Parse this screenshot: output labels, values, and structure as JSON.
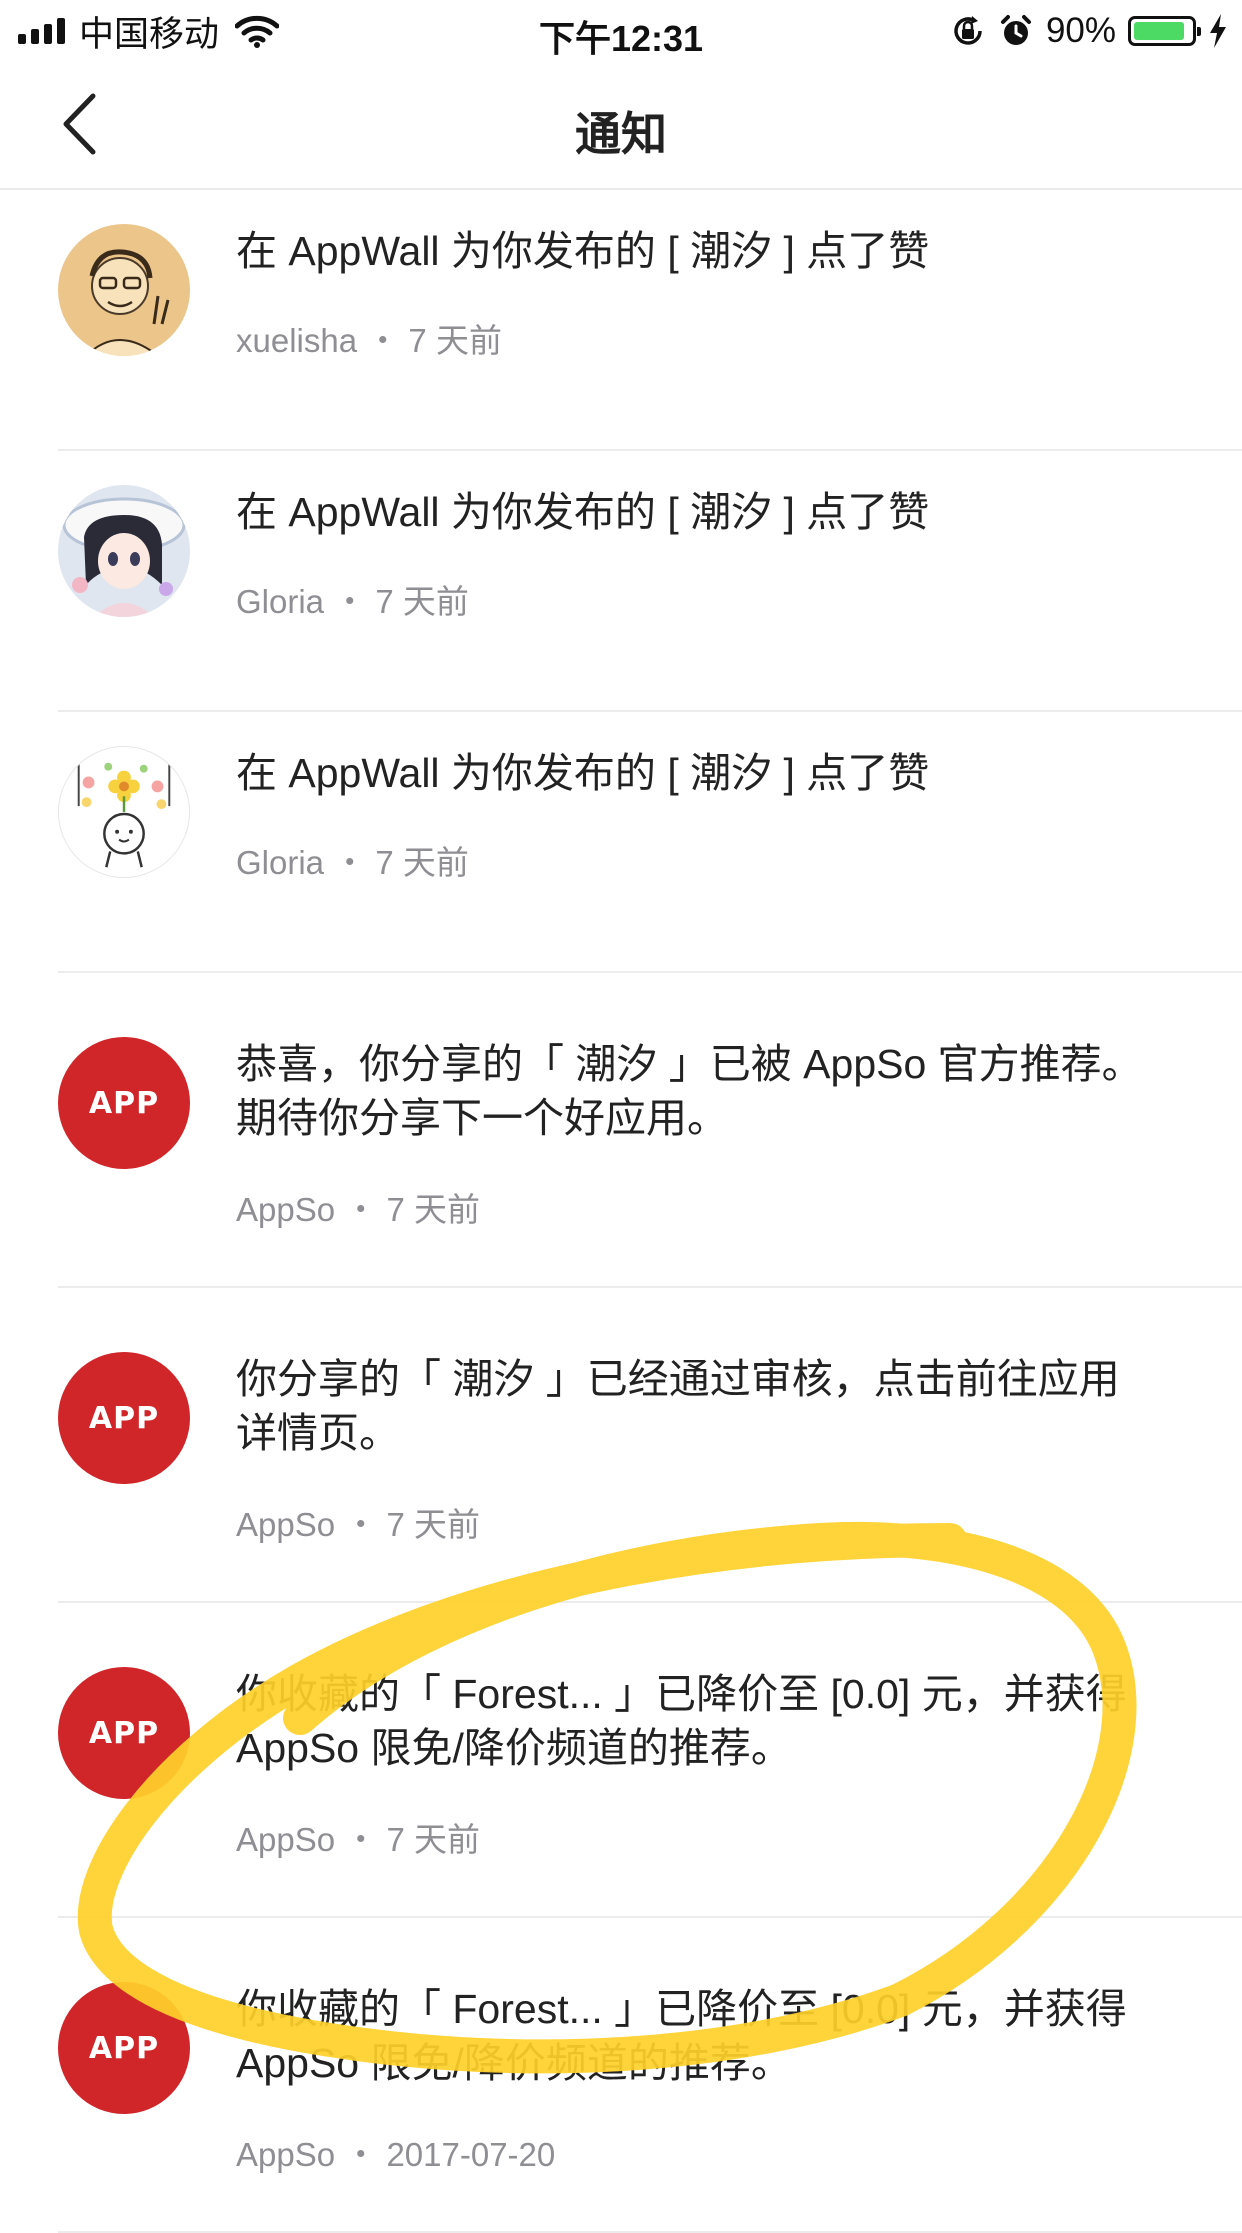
{
  "status_bar": {
    "carrier": "中国移动",
    "time": "下午12:31",
    "battery_percent": "90%",
    "battery_level": 0.9
  },
  "nav": {
    "title": "通知"
  },
  "notifications": [
    {
      "message": "在 AppWall 为你发布的 [ 潮汐 ] 点了赞",
      "user": "xuelisha",
      "separator": "・",
      "time": "7 天前",
      "avatar": "user-photo-avatar"
    },
    {
      "message": "在 AppWall 为你发布的 [ 潮汐 ] 点了赞",
      "user": "Gloria",
      "separator": "・",
      "time": "7 天前",
      "avatar": "anime-girl-avatar"
    },
    {
      "message": "在 AppWall 为你发布的 [ 潮汐 ] 点了赞",
      "user": "Gloria",
      "separator": "・",
      "time": "7 天前",
      "avatar": "flower-doodle-avatar"
    },
    {
      "message": "恭喜，你分享的「 潮汐 」已被 AppSo 官方推荐。期待你分享下一个好应用。",
      "user": "AppSo",
      "separator": "・",
      "time": "7 天前",
      "avatar_text": "APP"
    },
    {
      "message": "你分享的「 潮汐 」已经通过审核，点击前往应用详情页。",
      "user": "AppSo",
      "separator": "・",
      "time": "7 天前",
      "avatar_text": "APP"
    },
    {
      "message": "你收藏的「 Forest... 」已降价至 [0.0] 元，并获得 AppSo 限免/降价频道的推荐。",
      "user": "AppSo",
      "separator": "・",
      "time": "7 天前",
      "avatar_text": "APP"
    },
    {
      "message": "你收藏的「 Forest... 」已降价至 [0.0] 元，并获得 AppSo 限免/降价频道的推荐。",
      "user": "AppSo",
      "separator": "・",
      "time": "2017-07-20",
      "avatar_text": "APP"
    }
  ],
  "colors": {
    "app_avatar": "#d0262a",
    "highlight_scribble": "#ffd02a",
    "battery": "#4cd964"
  }
}
